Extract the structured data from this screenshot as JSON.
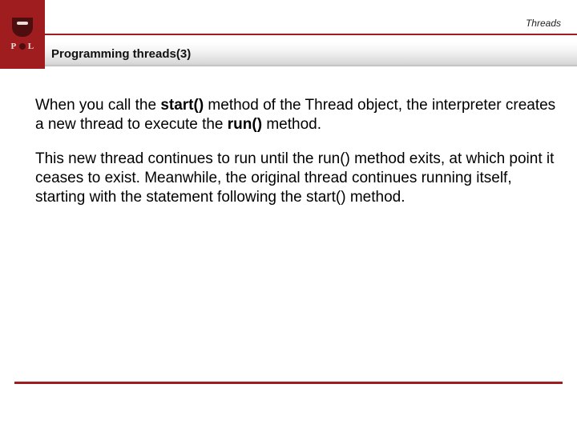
{
  "header": {
    "breadcrumb": "Threads",
    "title": "Programming threads(3)",
    "logo": {
      "p": "P",
      "l": "L"
    }
  },
  "body": {
    "p1_a": "When you call the ",
    "p1_b": "start()",
    "p1_c": " method of the Thread object, the interpreter creates a new thread to execute the ",
    "p1_d": "run()",
    "p1_e": " method.",
    "p2": "This new thread continues to run until the run() method exits, at which point it ceases to exist. Meanwhile, the original thread continues running itself, starting with the statement following the start() method."
  }
}
